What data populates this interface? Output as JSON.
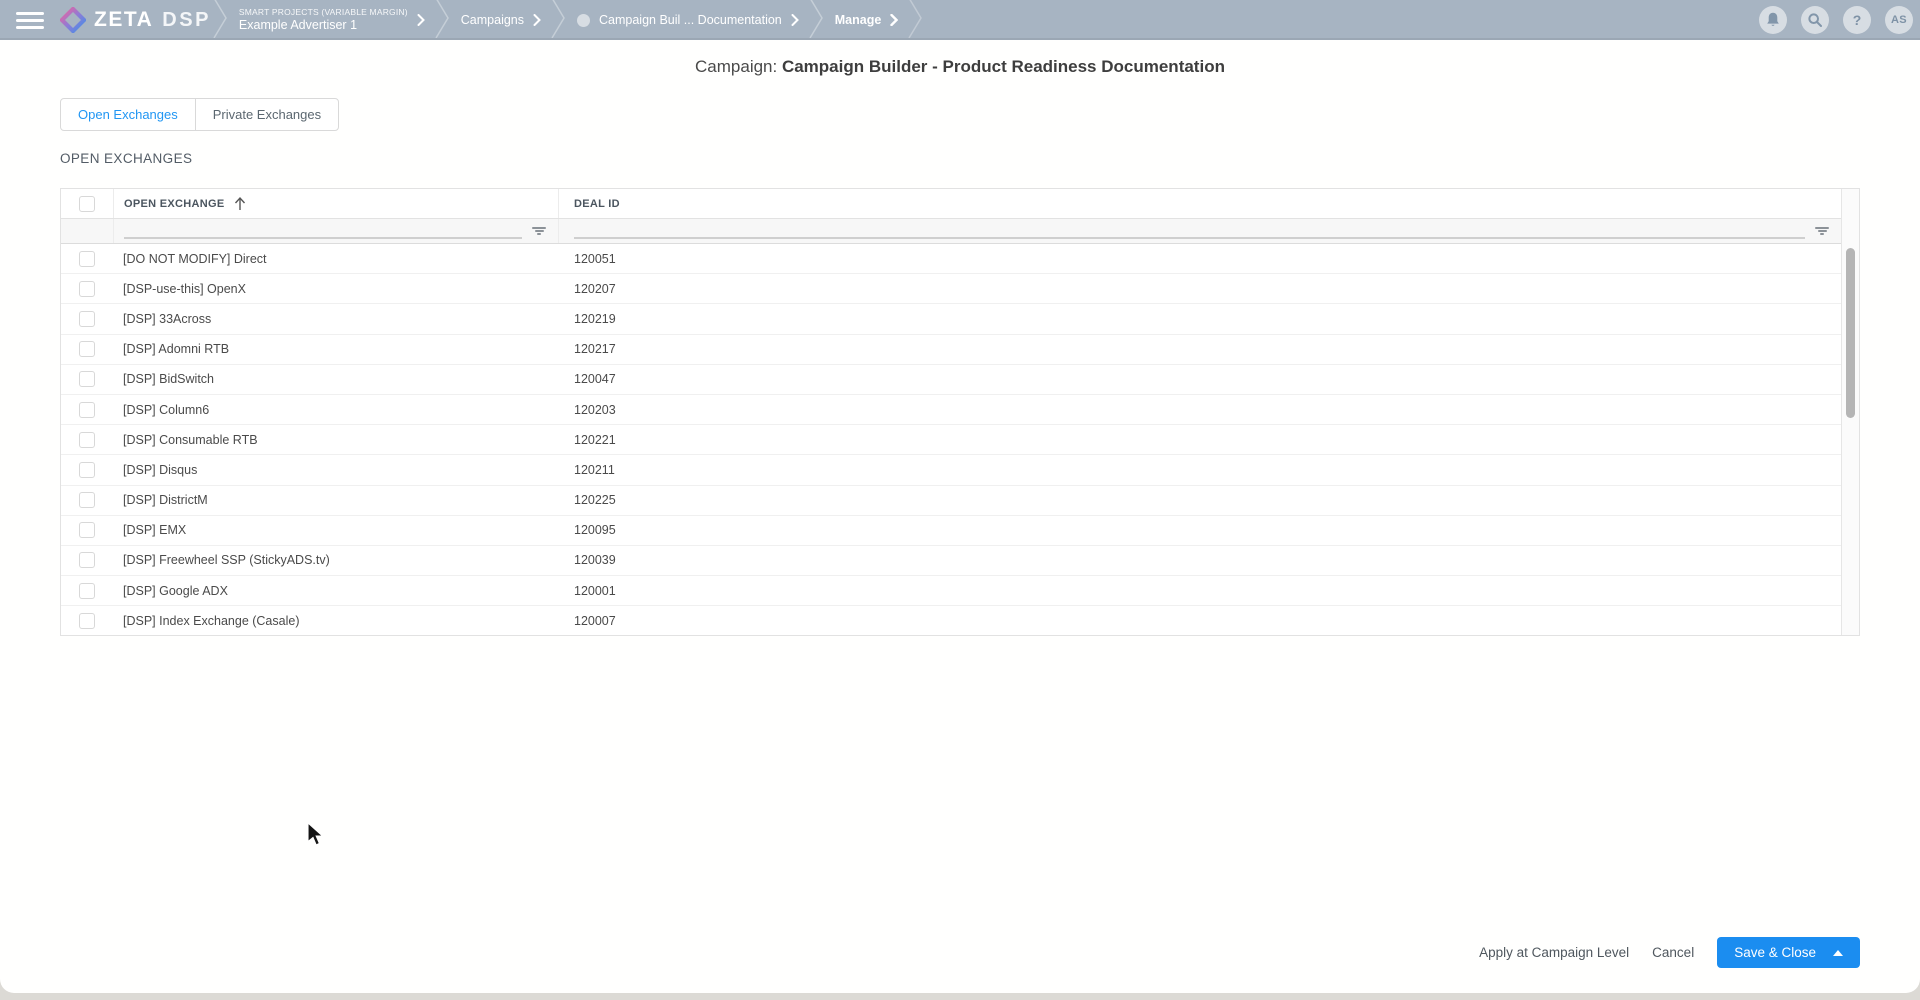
{
  "colors": {
    "accent_blue": "#1b8df0",
    "tab_active_blue": "#2196f3",
    "navbar_bg": "#a7b4c2"
  },
  "navbar": {
    "brand": "ZETA",
    "brand_suffix": "DSP",
    "breadcrumbs": {
      "project_eyebrow": "SMART PROJECTS (VARIABLE MARGIN)",
      "advertiser": "Example Advertiser 1",
      "campaigns": "Campaigns",
      "campaign": "Campaign Buil ... Documentation",
      "manage": "Manage"
    },
    "avatar_initials": "AS",
    "help_glyph": "?"
  },
  "page": {
    "title_prefix": "Campaign: ",
    "title": "Campaign Builder - Product Readiness Documentation"
  },
  "tabs": {
    "open": "Open Exchanges",
    "private": "Private Exchanges"
  },
  "section_heading": "OPEN EXCHANGES",
  "table": {
    "columns": {
      "exchange": "OPEN EXCHANGE",
      "deal": "DEAL ID"
    },
    "rows": [
      {
        "exchange": "[DO NOT MODIFY] Direct",
        "deal_id": "120051"
      },
      {
        "exchange": "[DSP-use-this] OpenX",
        "deal_id": "120207"
      },
      {
        "exchange": "[DSP] 33Across",
        "deal_id": "120219"
      },
      {
        "exchange": "[DSP] Adomni RTB",
        "deal_id": "120217"
      },
      {
        "exchange": "[DSP] BidSwitch",
        "deal_id": "120047"
      },
      {
        "exchange": "[DSP] Column6",
        "deal_id": "120203"
      },
      {
        "exchange": "[DSP] Consumable RTB",
        "deal_id": "120221"
      },
      {
        "exchange": "[DSP] Disqus",
        "deal_id": "120211"
      },
      {
        "exchange": "[DSP] DistrictM",
        "deal_id": "120225"
      },
      {
        "exchange": "[DSP] EMX",
        "deal_id": "120095"
      },
      {
        "exchange": "[DSP] Freewheel SSP (StickyADS.tv)",
        "deal_id": "120039"
      },
      {
        "exchange": "[DSP] Google ADX",
        "deal_id": "120001"
      },
      {
        "exchange": "[DSP] Index Exchange (Casale)",
        "deal_id": "120007"
      }
    ]
  },
  "footer": {
    "apply": "Apply at Campaign Level",
    "cancel": "Cancel",
    "save": "Save & Close"
  }
}
